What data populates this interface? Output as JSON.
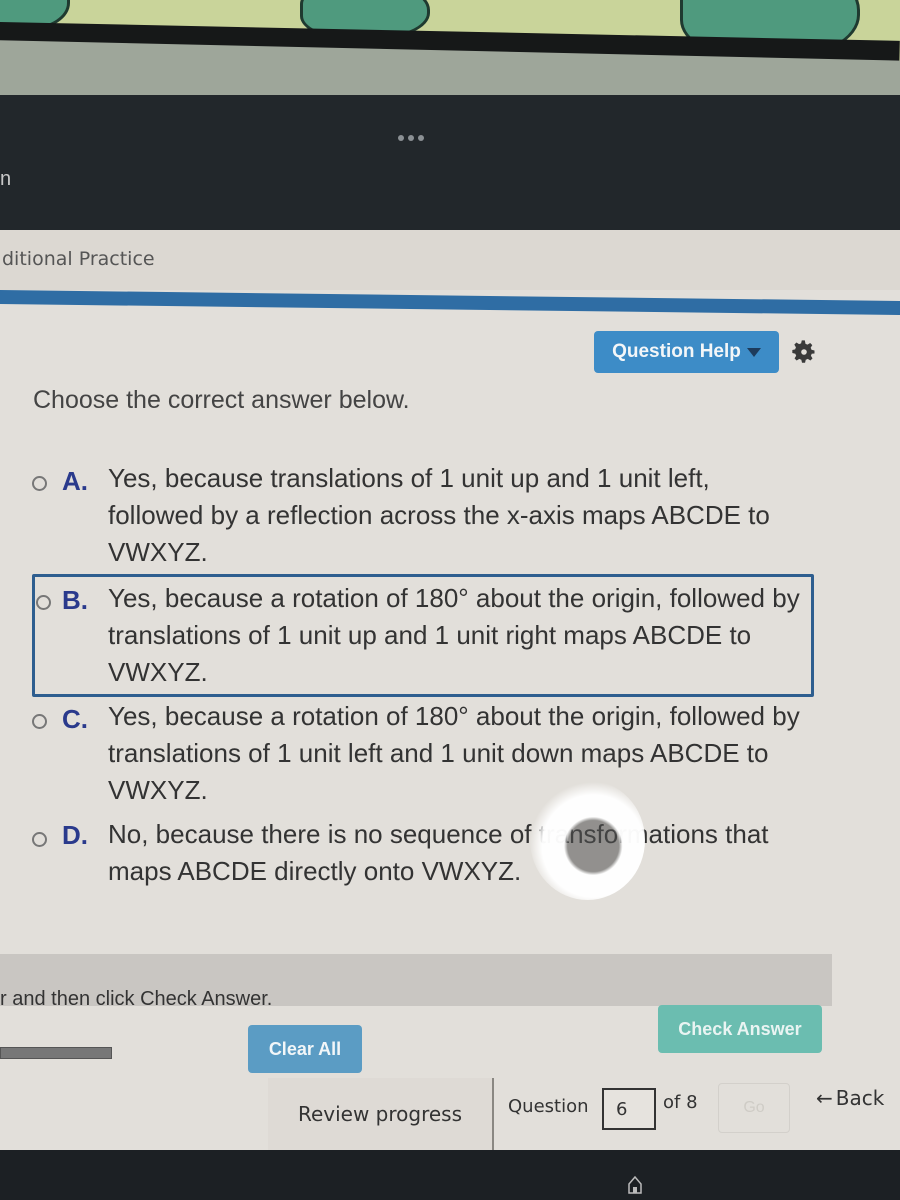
{
  "window": {
    "overflow_menu_icon": "ellipsis-icon",
    "partial_title_char": "n"
  },
  "header": {
    "title": "ditional Practice"
  },
  "toolbar": {
    "question_help_label": "Question Help",
    "question_help_icon": "caret-down-icon",
    "settings_icon": "gear-icon"
  },
  "question": {
    "prompt": "Choose the correct answer below.",
    "selected_option": null,
    "focused_option": "B",
    "options": [
      {
        "letter": "A.",
        "text": "Yes, because translations of 1 unit up and 1 unit left, followed by a reflection across the x-axis maps ABCDE to VWXYZ."
      },
      {
        "letter": "B.",
        "text": "Yes, because a rotation of 180° about the origin, followed by translations of 1 unit up and 1 unit right maps ABCDE to VWXYZ."
      },
      {
        "letter": "C.",
        "text": "Yes, because a rotation of 180° about the origin, followed by translations of 1 unit left and 1 unit down maps ABCDE to VWXYZ."
      },
      {
        "letter": "D.",
        "text": "No, because there is no sequence of transformations that maps ABCDE directly onto VWXYZ."
      }
    ]
  },
  "instructions": {
    "text": "r and then click Check Answer."
  },
  "actions": {
    "clear_all_label": "Clear All",
    "check_answer_label": "Check Answer"
  },
  "footer": {
    "review_progress_label": "Review progress",
    "question_label": "Question",
    "current_question": "6",
    "of_total": "of 8",
    "go_label": "Go",
    "back_label": "Back",
    "back_icon": "arrow-left-icon"
  },
  "colors": {
    "primary_blue": "#3d8cc7",
    "header_rule": "#2f6da4",
    "check_answer_teal": "#6bbdb0",
    "option_letter": "#2a3a8c",
    "focus_border": "#2e5e8f"
  }
}
